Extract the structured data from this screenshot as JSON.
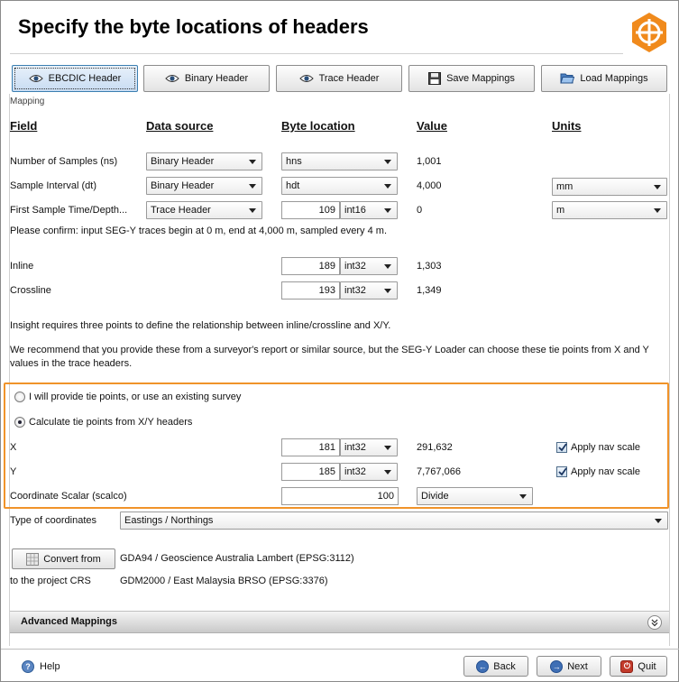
{
  "header": {
    "title": "Specify the byte locations of headers"
  },
  "tabs": [
    {
      "label": "EBCDIC Header",
      "icon": "eye-icon"
    },
    {
      "label": "Binary Header",
      "icon": "eye-icon"
    },
    {
      "label": "Trace Header",
      "icon": "eye-icon"
    },
    {
      "label": "Save Mappings",
      "icon": "floppy-disk-icon"
    },
    {
      "label": "Load Mappings",
      "icon": "folder-open-icon"
    }
  ],
  "mapping": {
    "section_label": "Mapping",
    "columns": {
      "field": "Field",
      "data_source": "Data source",
      "byte_location": "Byte location",
      "value": "Value",
      "units": "Units"
    },
    "rows": {
      "samples": {
        "label": "Number of Samples (ns)",
        "source": "Binary Header",
        "byte": "hns",
        "value": "1,001"
      },
      "interval": {
        "label": "Sample Interval (dt)",
        "source": "Binary Header",
        "byte": "hdt",
        "value": "4,000",
        "units": "mm"
      },
      "first_sample": {
        "label": "First Sample Time/Depth...",
        "source": "Trace Header",
        "byte": "109",
        "type": "int16",
        "value": "0",
        "units": "m"
      }
    },
    "confirm_text": "Please confirm: input SEG-Y traces begin at 0 m, end at 4,000 m, sampled every 4 m.",
    "inline": {
      "label": "Inline",
      "byte": "189",
      "type": "int32",
      "value": "1,303"
    },
    "crossline": {
      "label": "Crossline",
      "byte": "193",
      "type": "int32",
      "value": "1,349"
    },
    "info1": "Insight requires three points to define the relationship between inline/crossline and X/Y.",
    "info2a": "We recommend that you provide these from a surveyor's report or similar source, but the SEG-Y Loader can choose these tie points from X and Y",
    "info2b": "values in the trace headers.",
    "radio_provide": "I will provide tie points, or use an existing survey",
    "radio_calculate": "Calculate tie points from X/Y headers",
    "x": {
      "label": "X",
      "byte": "181",
      "type": "int32",
      "value": "291,632",
      "nav_label": "Apply nav scale"
    },
    "y": {
      "label": "Y",
      "byte": "185",
      "type": "int32",
      "value": "7,767,066",
      "nav_label": "Apply nav scale"
    },
    "scalar": {
      "label": "Coordinate Scalar (scalco)",
      "value": "100",
      "mode": "Divide"
    },
    "coord_type": {
      "label": "Type of coordinates",
      "value": "Eastings / Northings"
    },
    "convert": {
      "button": "Convert from",
      "from_crs": "GDA94 / Geoscience Australia Lambert (EPSG:3112)",
      "to_label": "to the project CRS",
      "to_crs": "GDM2000 / East Malaysia BRSO (EPSG:3376)"
    },
    "advanced": "Advanced Mappings"
  },
  "footer": {
    "help": "Help",
    "back": "Back",
    "next": "Next",
    "quit": "Quit"
  },
  "colors": {
    "accent_orange": "#f0932a",
    "logo_orange": "#f08a1c",
    "active_tab": "#3c7fb1"
  }
}
